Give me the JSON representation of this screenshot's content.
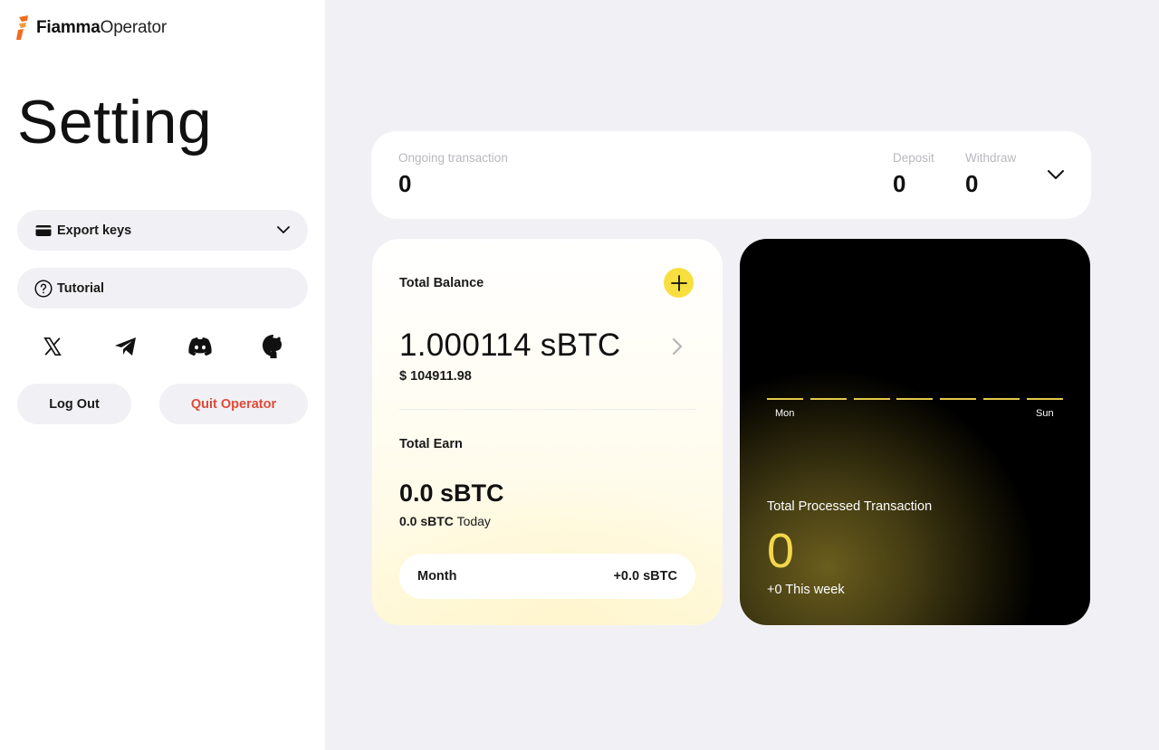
{
  "app": {
    "brand": "Fiamma",
    "product": "Operator"
  },
  "colors": {
    "accent_yellow": "#f7df3f",
    "danger_red": "#e04a36",
    "logo_orange": "#f26b1d",
    "page_bg": "#f1f1f5"
  },
  "sidebar": {
    "title": "Setting",
    "export_keys": {
      "label": "Export keys",
      "icon": "card-icon",
      "expand_icon": "chevron-down-icon"
    },
    "tutorial": {
      "label": "Tutorial",
      "icon": "question-circle-icon"
    },
    "socials": [
      {
        "name": "x-icon"
      },
      {
        "name": "telegram-icon"
      },
      {
        "name": "discord-icon"
      },
      {
        "name": "github-icon"
      }
    ],
    "logout_label": "Log Out",
    "quit_label": "Quit Operator"
  },
  "transactions": {
    "ongoing_label": "Ongoing transaction",
    "ongoing_value": "0",
    "deposit_label": "Deposit",
    "deposit_value": "0",
    "withdraw_label": "Withdraw",
    "withdraw_value": "0"
  },
  "balance": {
    "label": "Total Balance",
    "value": "1.000114 sBTC",
    "usd": "$ 104911.98",
    "earn_label": "Total Earn",
    "earn_value": "0.0 sBTC",
    "earn_today_value": "0.0 sBTC",
    "earn_today_suffix": "Today",
    "month_label": "Month",
    "month_value": "+0.0 sBTC"
  },
  "processed": {
    "day_start": "Mon",
    "day_end": "Sun",
    "weekly_values": [
      0,
      0,
      0,
      0,
      0,
      0,
      0
    ],
    "label": "Total Processed Transaction",
    "value": "0",
    "week_text": "+0 This week"
  }
}
